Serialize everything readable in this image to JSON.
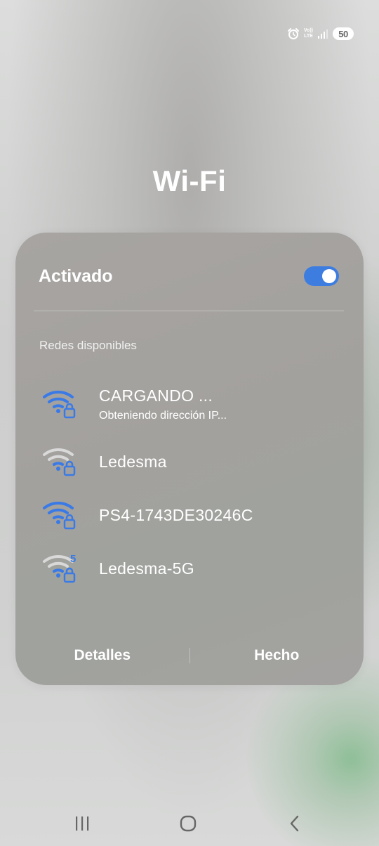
{
  "status_bar": {
    "icons": [
      "alarm-icon",
      "volte-lte-icon",
      "signal-icon"
    ],
    "volte_top": "Vo))",
    "volte_bottom": "LTE",
    "battery": "50"
  },
  "title": "Wi-Fi",
  "wifi_panel": {
    "toggle_label": "Activado",
    "toggle_on": true,
    "section_title": "Redes disponibles",
    "networks": [
      {
        "name": "CARGANDO ...",
        "status": "Obteniendo dirección IP...",
        "signal_color": "#3a7ae6",
        "secured": true,
        "band": ""
      },
      {
        "name": "Ledesma",
        "status": "",
        "signal_color": "#d9d9d9",
        "secured": true,
        "band": ""
      },
      {
        "name": "PS4-1743DE30246C",
        "status": "",
        "signal_color": "#3a7ae6",
        "secured": true,
        "band": ""
      },
      {
        "name": "Ledesma-5G",
        "status": "",
        "signal_color": "#d9d9d9",
        "secured": true,
        "band": "5"
      }
    ],
    "details_label": "Detalles",
    "done_label": "Hecho"
  },
  "colors": {
    "accent": "#3e7de0",
    "lock": "#3a7ae6"
  },
  "nav_bar": {
    "buttons": [
      "recents-icon",
      "home-icon",
      "back-icon"
    ]
  }
}
